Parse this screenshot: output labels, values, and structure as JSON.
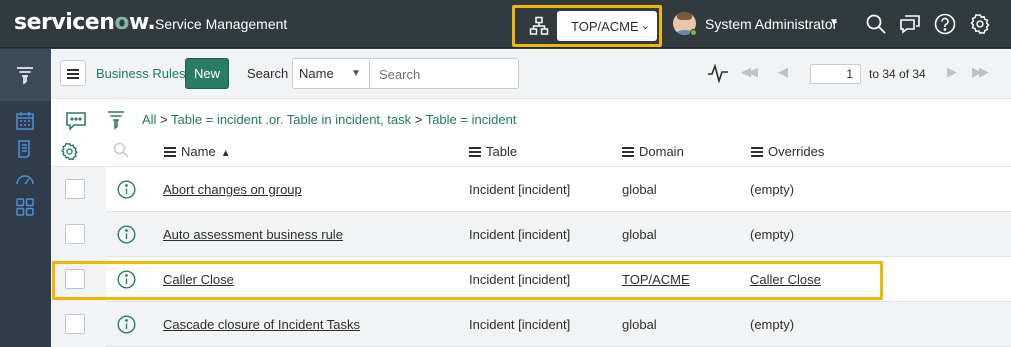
{
  "header": {
    "logo": {
      "pre": "servicen",
      "o": "o",
      "post": "w."
    },
    "app_title": "Service Management",
    "domain": "TOP/ACME",
    "user_name": "System Administrator"
  },
  "list": {
    "title": "Business Rules",
    "new_label": "New",
    "search_label": "Search",
    "search_field": "Name",
    "search_placeholder": "Search",
    "page_value": "1",
    "page_total": "to 34 of 34"
  },
  "breadcrumb": {
    "all": "All",
    "crumb1": "Table = incident .or. Table in incident, task",
    "crumb2": "Table = incident"
  },
  "columns": {
    "name": "Name",
    "table": "Table",
    "domain": "Domain",
    "overrides": "Overrides"
  },
  "rows": [
    {
      "name": "Abort changes on group",
      "table": "Incident [incident]",
      "domain": "global",
      "overrides": "(empty)"
    },
    {
      "name": "Auto assessment business rule",
      "table": "Incident [incident]",
      "domain": "global",
      "overrides": "(empty)"
    },
    {
      "name": "Caller Close",
      "table": "Incident [incident]",
      "domain": "TOP/ACME",
      "overrides": "Caller Close"
    },
    {
      "name": "Cascade closure of Incident Tasks",
      "table": "Incident [incident]",
      "domain": "global",
      "overrides": "(empty)"
    }
  ],
  "colors": {
    "header_bg": "#303a3f",
    "accent_green": "#2b7c66",
    "highlight": "#f2b705"
  }
}
